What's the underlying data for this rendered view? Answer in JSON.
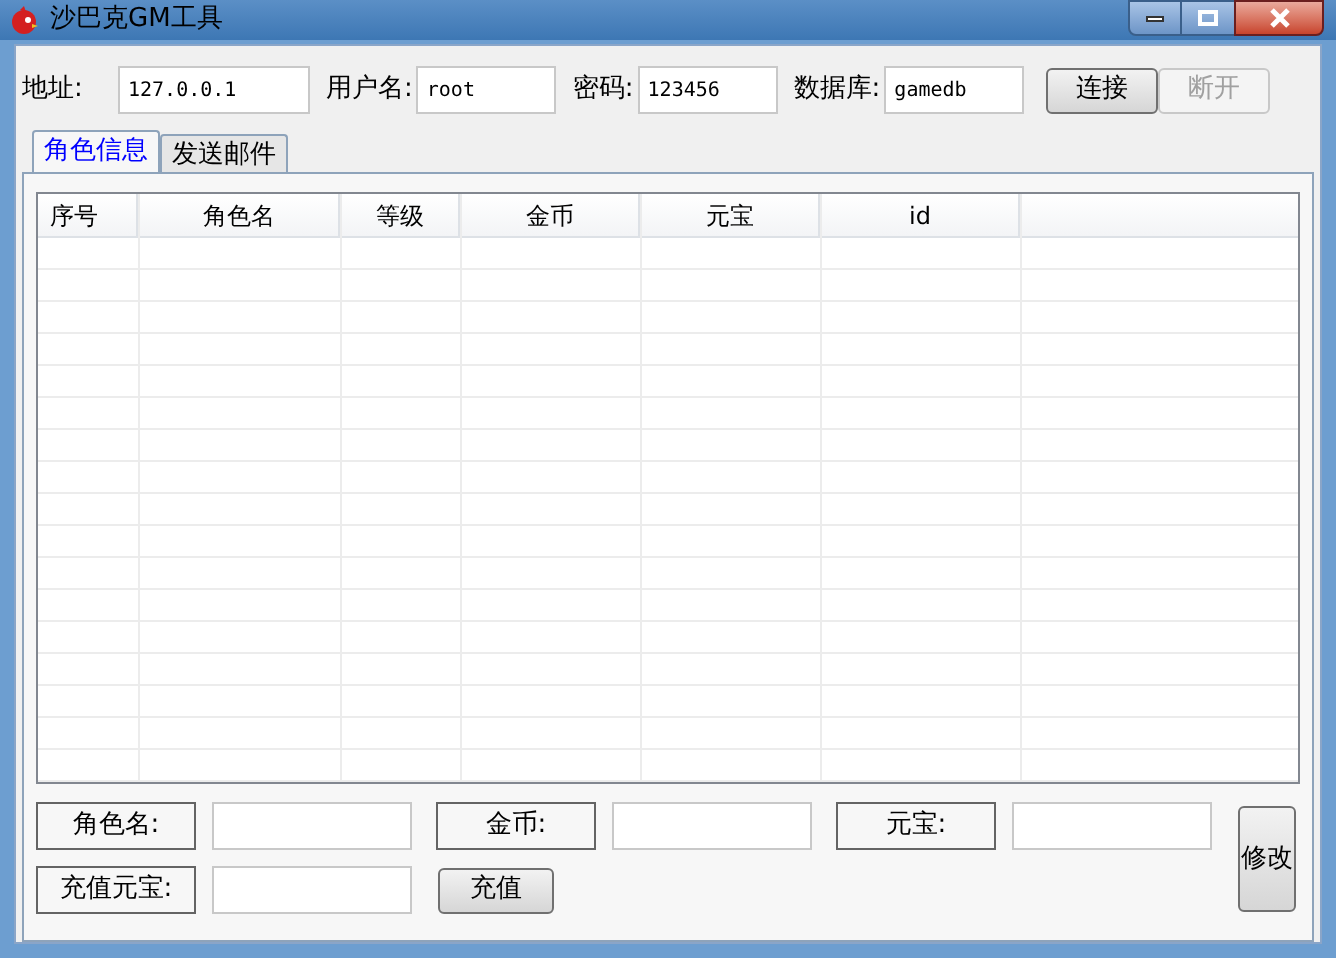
{
  "window": {
    "title": "沙巴克GM工具"
  },
  "connection": {
    "fields": [
      {
        "label": "地址:",
        "value": "127.0.0.1"
      },
      {
        "label": "用户名:",
        "value": "root"
      },
      {
        "label": "密码:",
        "value": "123456"
      },
      {
        "label": "数据库:",
        "value": "gamedb"
      }
    ],
    "buttons": [
      {
        "label": "连接",
        "disabled": false
      },
      {
        "label": "断开",
        "disabled": true
      }
    ]
  },
  "tabs": [
    {
      "label": "角色信息",
      "selected": true
    },
    {
      "label": "发送邮件",
      "selected": false
    }
  ],
  "table": {
    "columns": [
      "序号",
      "角色名",
      "等级",
      "金币",
      "元宝",
      "id"
    ]
  },
  "edit_form": {
    "fields": [
      {
        "label": "角色名:"
      },
      {
        "label": "金币:"
      },
      {
        "label": "元宝:"
      }
    ],
    "recharge_label": "充值元宝:",
    "recharge_button": "充值",
    "modify_button": "修改"
  }
}
